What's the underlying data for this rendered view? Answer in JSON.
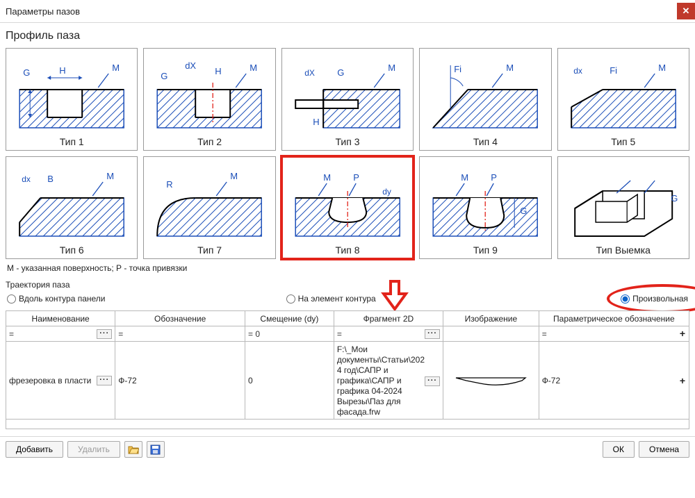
{
  "window": {
    "title": "Параметры пазов"
  },
  "section_profile": "Профиль паза",
  "profiles": [
    {
      "id": "type1",
      "label": "Тип 1"
    },
    {
      "id": "type2",
      "label": "Тип 2"
    },
    {
      "id": "type3",
      "label": "Тип 3"
    },
    {
      "id": "type4",
      "label": "Тип 4"
    },
    {
      "id": "type5",
      "label": "Тип 5"
    },
    {
      "id": "type6",
      "label": "Тип 6"
    },
    {
      "id": "type7",
      "label": "Тип 7"
    },
    {
      "id": "type8",
      "label": "Тип 8"
    },
    {
      "id": "type9",
      "label": "Тип 9"
    },
    {
      "id": "type10",
      "label": "Тип Выемка"
    }
  ],
  "selected_profile": "type8",
  "legend": "М - указанная поверхность; Р - точка привязки",
  "trajectory": {
    "label": "Траектория паза",
    "options": {
      "along": "Вдоль контура панели",
      "on_element": "На элемент контура",
      "arbitrary": "Произвольная"
    },
    "selected": "arbitrary"
  },
  "table": {
    "headers": {
      "name": "Наименование",
      "designation": "Обозначение",
      "offset_dy": "Смещение (dy)",
      "fragment2d": "Фрагмент 2D",
      "image": "Изображение",
      "param_designation": "Параметрическое обозначение"
    },
    "filters": {
      "name": "=",
      "designation": "=",
      "offset_dy": "=   0",
      "fragment2d": "=",
      "image": "",
      "param_designation": "="
    },
    "rows": [
      {
        "name": "фрезеровка в пласти",
        "designation": "Ф-72",
        "offset_dy": "0",
        "fragment2d": "F:\\_Мои документы\\Статьи\\2024 год\\САПР и графика\\САПР и графика 04-2024 Вырезы\\Паз для фасада.frw",
        "image": "shape-thumb",
        "param_designation": "Ф-72"
      }
    ]
  },
  "buttons": {
    "add": "Добавить",
    "delete": "Удалить",
    "ok": "ОК",
    "cancel": "Отмена"
  },
  "ellipsis": "···",
  "plus": "+"
}
